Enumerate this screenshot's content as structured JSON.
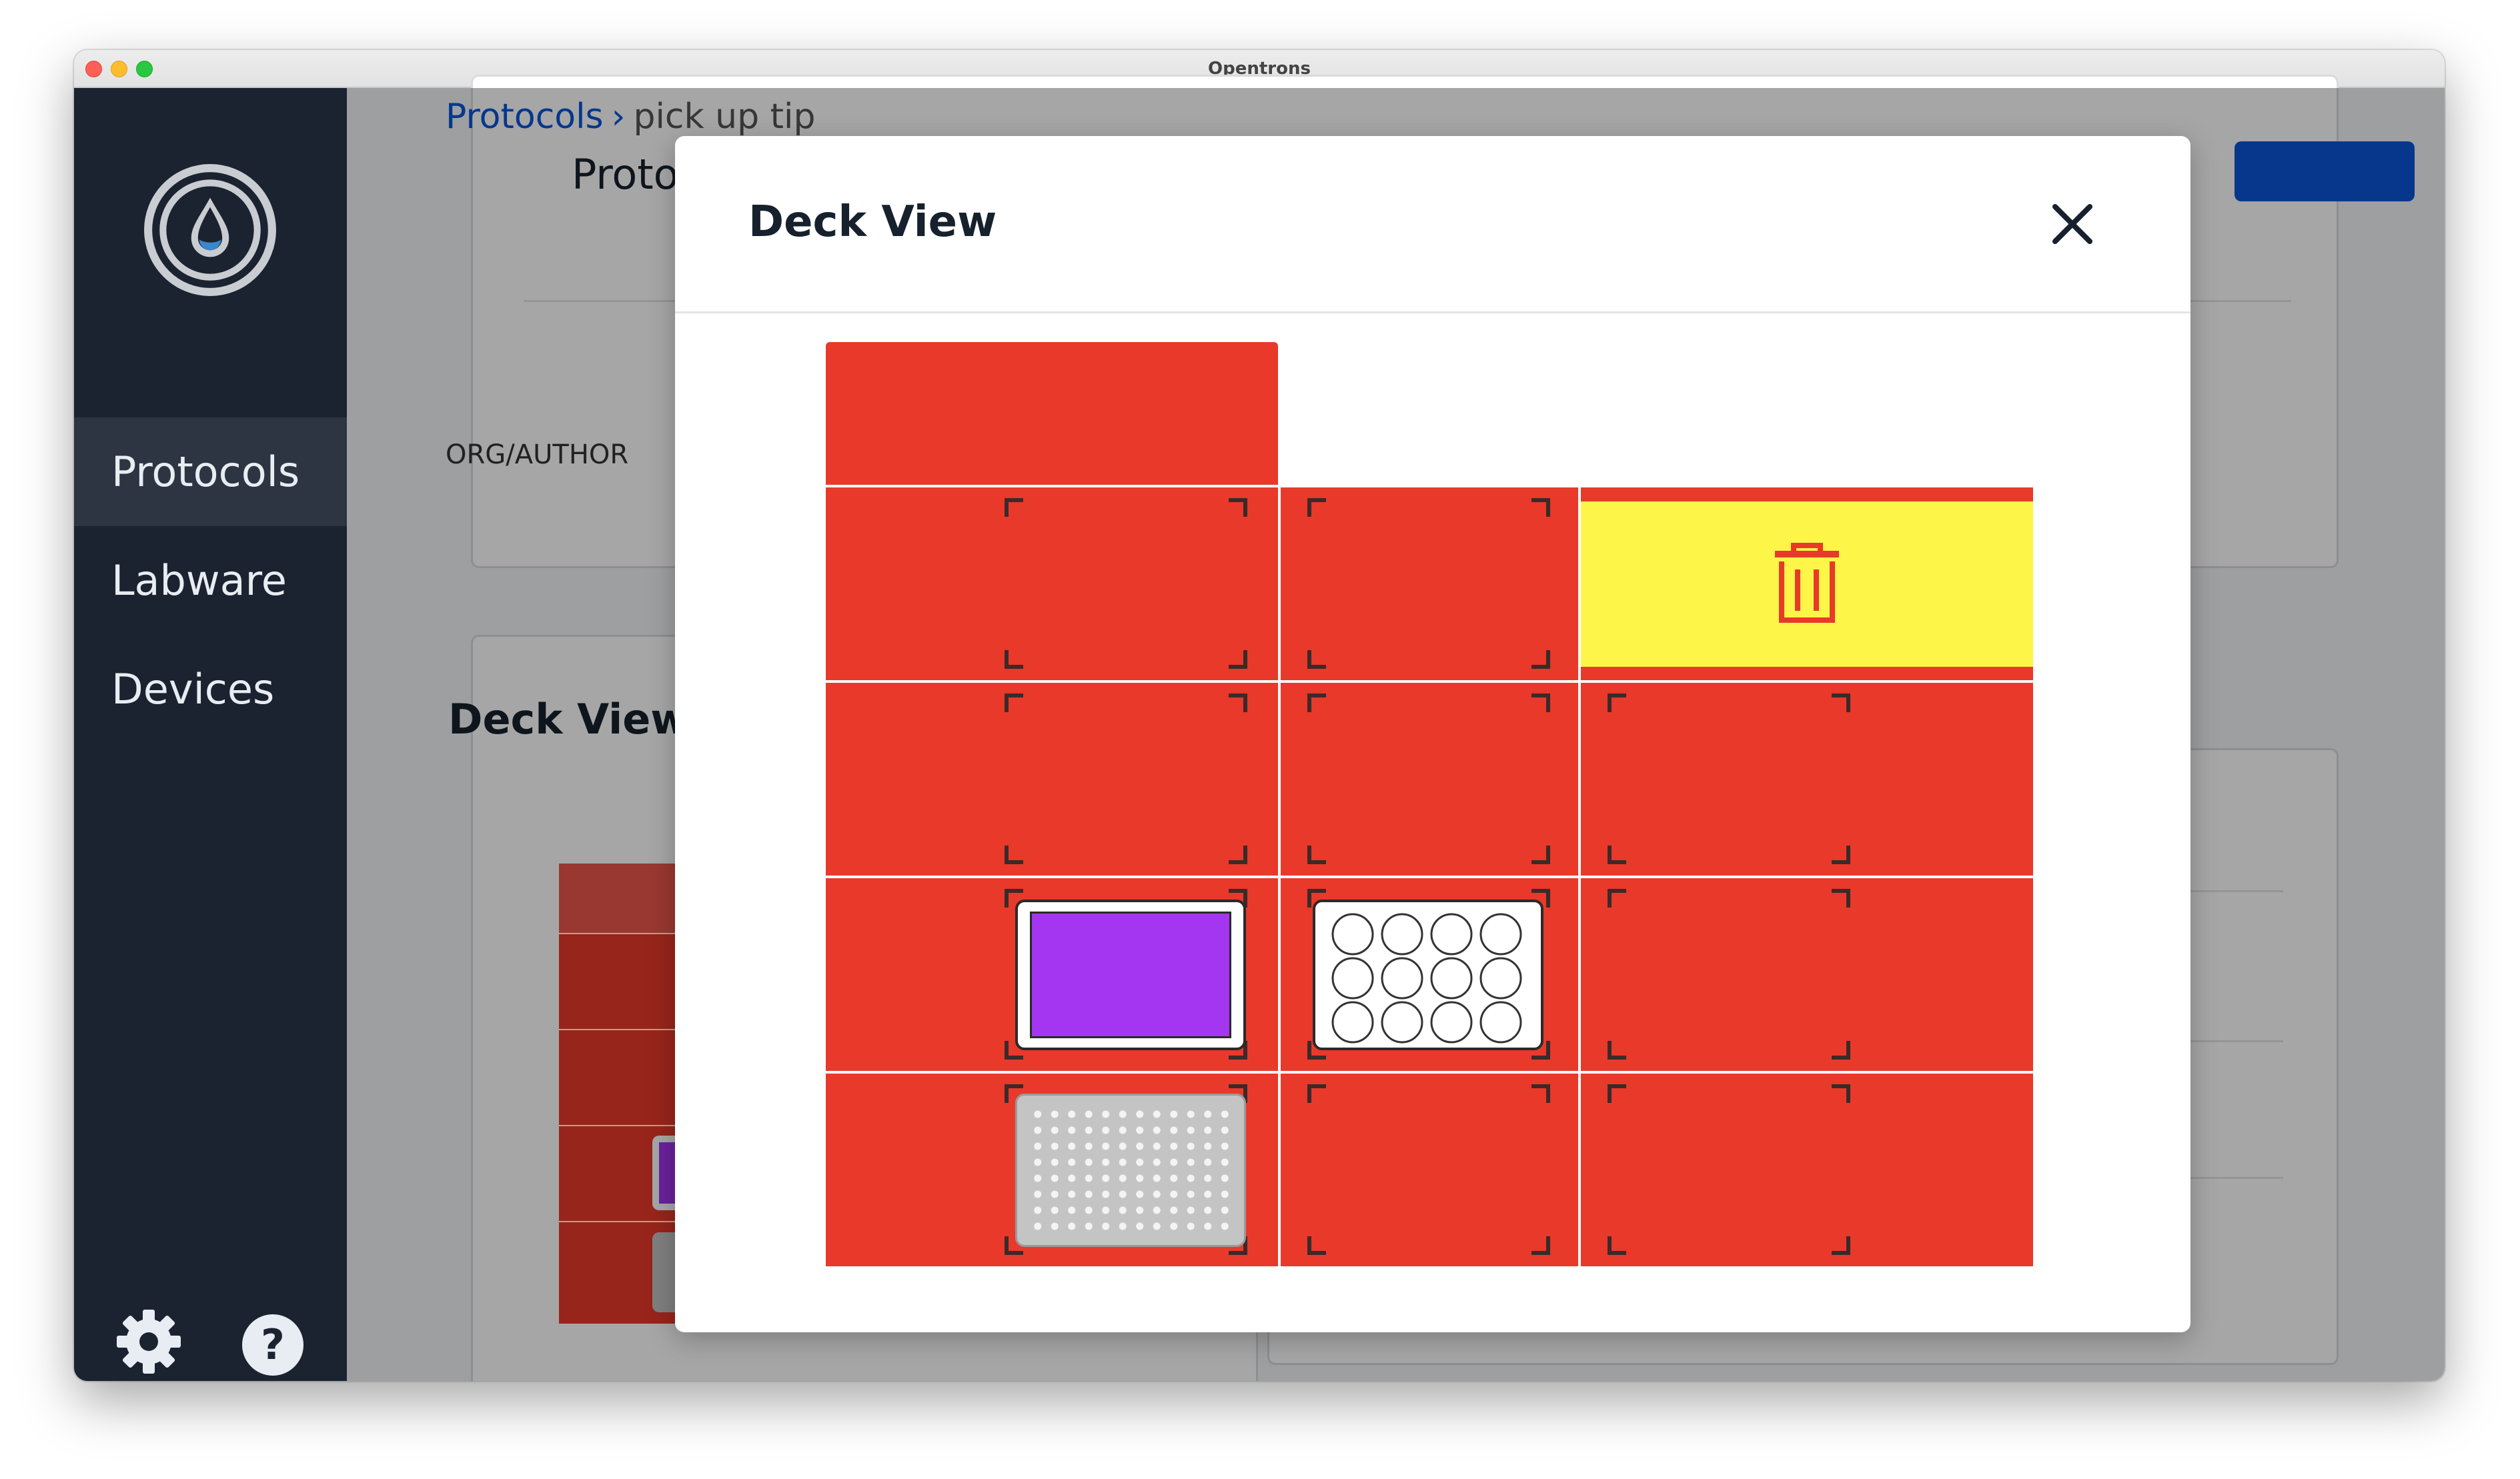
{
  "window": {
    "title": "Opentrons"
  },
  "sidebar": {
    "items": [
      {
        "label": "Protocols",
        "active": true
      },
      {
        "label": "Labware",
        "active": false
      },
      {
        "label": "Devices",
        "active": false
      }
    ],
    "footer_icons": [
      "gear-icon",
      "help-icon"
    ],
    "help_glyph": "?"
  },
  "breadcrumb": {
    "parent": "Protocols",
    "separator": "›",
    "current": "pick up tip"
  },
  "background": {
    "protocol_description_title": "Protocol Des",
    "org_author_label": "ORG/AUTHOR",
    "deck_view_title": "Deck View"
  },
  "modal": {
    "title": "Deck View",
    "close_icon": "close-icon",
    "trash_icon": "trash-icon"
  },
  "colors": {
    "slot_red": "#e9392a",
    "trash_yellow": "#fdf548",
    "sidebar_bg": "#1b2330",
    "link_blue": "#0a55d8",
    "reservoir_purple": "#a435f0",
    "tiprack_gray": "#c4c4c4"
  }
}
